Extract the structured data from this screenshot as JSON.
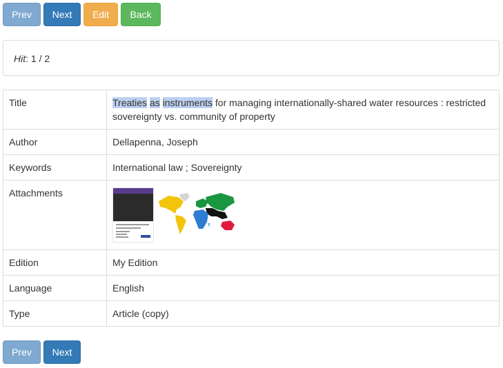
{
  "nav_top": {
    "prev": "Prev",
    "next": "Next",
    "edit": "Edit",
    "back": "Back"
  },
  "hit": {
    "label": "Hit",
    "separator": ":",
    "value": "1 / 2"
  },
  "record": {
    "title_label": "Title",
    "title_hl_1": "Treaties",
    "title_hl_2": "as",
    "title_hl_3": "instruments",
    "title_rest": "for managing internationally-shared water resources : restricted sovereignty vs. community of property",
    "author_label": "Author",
    "author": "Dellapenna, Joseph",
    "keywords_label": "Keywords",
    "keywords": "International law ; Sovereignty",
    "attachments_label": "Attachments",
    "attachments": [
      {
        "icon": "document-cover-thumbnail"
      },
      {
        "icon": "world-map-thumbnail"
      }
    ],
    "edition_label": "Edition",
    "edition": "My Edition",
    "language_label": "Language",
    "language": "English",
    "type_label": "Type",
    "type": "Article (copy)"
  },
  "nav_bottom": {
    "prev": "Prev",
    "next": "Next"
  },
  "colors": {
    "prev_button": "#7fa9d0",
    "next_button": "#337ab7",
    "edit_button": "#f0ad4e",
    "back_button": "#5cb85c",
    "highlight": "#bcd0ef",
    "border": "#dddddd"
  }
}
